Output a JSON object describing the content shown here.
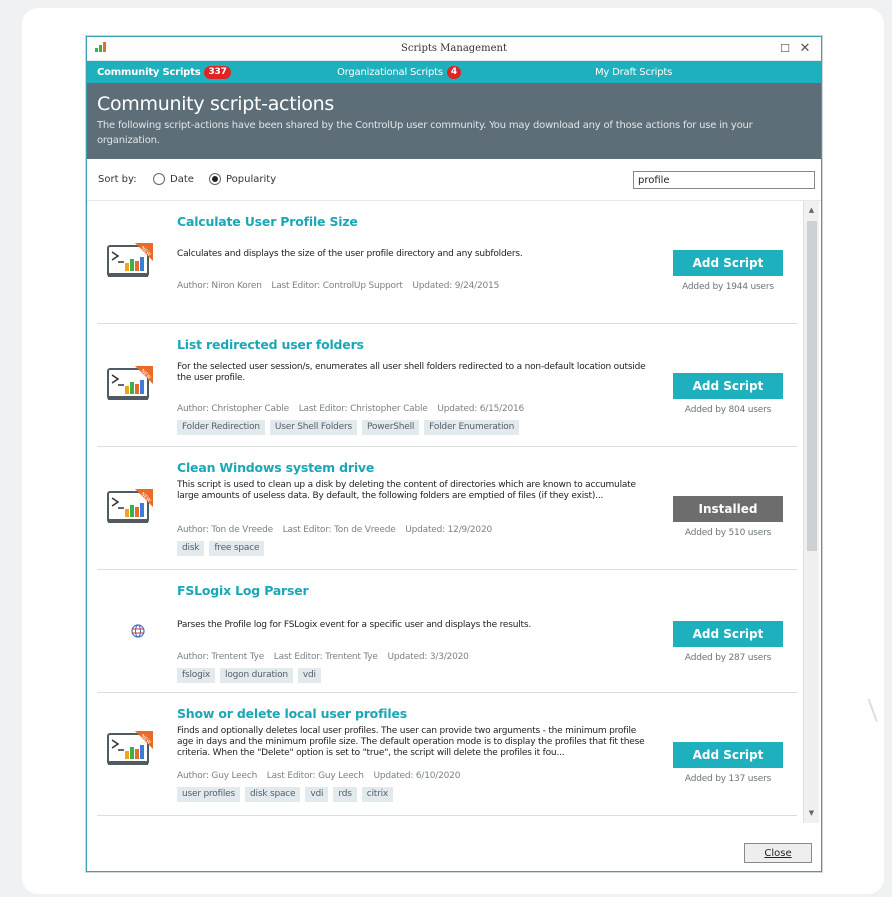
{
  "window": {
    "title": "Scripts Management",
    "maximize_glyph": "☐",
    "close_glyph": "✕"
  },
  "tabs": [
    {
      "label": "Community Scripts",
      "badge": "337",
      "active": true
    },
    {
      "label": "Organizational Scripts",
      "badge": "4",
      "active": false
    },
    {
      "label": "My Draft Scripts",
      "badge": "",
      "active": false
    }
  ],
  "header": {
    "title": "Community script-actions",
    "description": "The following script-actions have been shared by the ControlUp user community. You may download any of those actions for use in your organization."
  },
  "sort": {
    "label": "Sort by:",
    "options": [
      "Date",
      "Popularity"
    ],
    "selected": "Popularity"
  },
  "search": {
    "value": "profile"
  },
  "items": [
    {
      "title": "Calculate User Profile Size",
      "description": "Calculates and displays the size of the user profile directory and any subfolders.",
      "author": "Author: Niron Koren",
      "last_editor": "Last Editor: ControlUp Support",
      "updated": "Updated: 9/24/2015",
      "tags": [],
      "button": "Add Script",
      "added_by": "Added by 1944 users",
      "icon": "script-icon-new"
    },
    {
      "title": "List redirected user folders",
      "description": "For the selected user session/s, enumerates all user shell folders redirected to a non-default location outside the user profile.",
      "author": "Author: Christopher Cable",
      "last_editor": "Last Editor: Christopher Cable",
      "updated": "Updated: 6/15/2016",
      "tags": [
        "Folder Redirection",
        "User Shell Folders",
        "PowerShell",
        "Folder Enumeration"
      ],
      "button": "Add Script",
      "added_by": "Added by 804 users",
      "icon": "script-icon-new"
    },
    {
      "title": "Clean Windows system drive",
      "description": "This script is used to clean up a disk by deleting the content of directories which are known to accumulate large amounts of useless data. By default, the following folders are emptied of files (if they exist)...",
      "author": "Author: Ton de Vreede",
      "last_editor": "Last Editor: Ton de Vreede",
      "updated": "Updated: 12/9/2020",
      "tags": [
        "disk",
        "free space"
      ],
      "button": "Installed",
      "added_by": "Added by 510 users",
      "icon": "script-icon-new"
    },
    {
      "title": "FSLogix Log Parser",
      "description": "Parses the Profile log for FSLogix event for a specific user and displays the results.",
      "author": "Author: Trentent Tye",
      "last_editor": "Last Editor: Trentent Tye",
      "updated": "Updated: 3/3/2020",
      "tags": [
        "fslogix",
        "logon duration",
        "vdi"
      ],
      "button": "Add Script",
      "added_by": "Added by 287 users",
      "icon": "globe-icon"
    },
    {
      "title": "Show or delete local user profiles",
      "description": "Finds and optionally deletes local user profiles. The user can provide two arguments - the minimum profile age in days and the minimum profile size. The default operation mode is to display the profiles that fit these criteria. When the \"Delete\" option is set to \"true\", the script will delete the profiles it fou...",
      "author": "Author: Guy Leech",
      "last_editor": "Last Editor: Guy Leech",
      "updated": "Updated: 6/10/2020",
      "tags": [
        "user profiles",
        "disk space",
        "vdi",
        "rds",
        "citrix"
      ],
      "button": "Add Script",
      "added_by": "Added by 137 users",
      "icon": "script-icon-new"
    }
  ],
  "scrollbar": {
    "up": "▲",
    "down": "▼"
  },
  "footer": {
    "close_label": "Close"
  },
  "colors": {
    "accent": "#1fb0bd",
    "header_bg": "#5d6e78",
    "title_text": "#1aa7b6",
    "badge": "#e02424",
    "installed": "#6d6d6d"
  }
}
